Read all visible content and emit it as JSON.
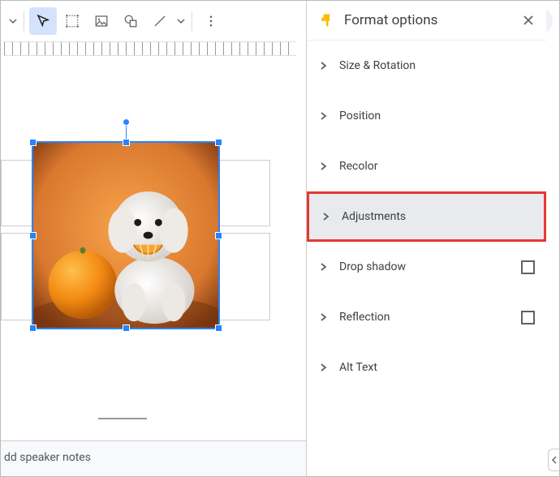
{
  "panel": {
    "title": "Format options",
    "rows": {
      "size": "Size & Rotation",
      "position": "Position",
      "recolor": "Recolor",
      "adjustments": "Adjustments",
      "dropshadow": "Drop shadow",
      "reflection": "Reflection",
      "alttext": "Alt Text"
    }
  },
  "notes": {
    "placeholder": "dd speaker notes"
  }
}
